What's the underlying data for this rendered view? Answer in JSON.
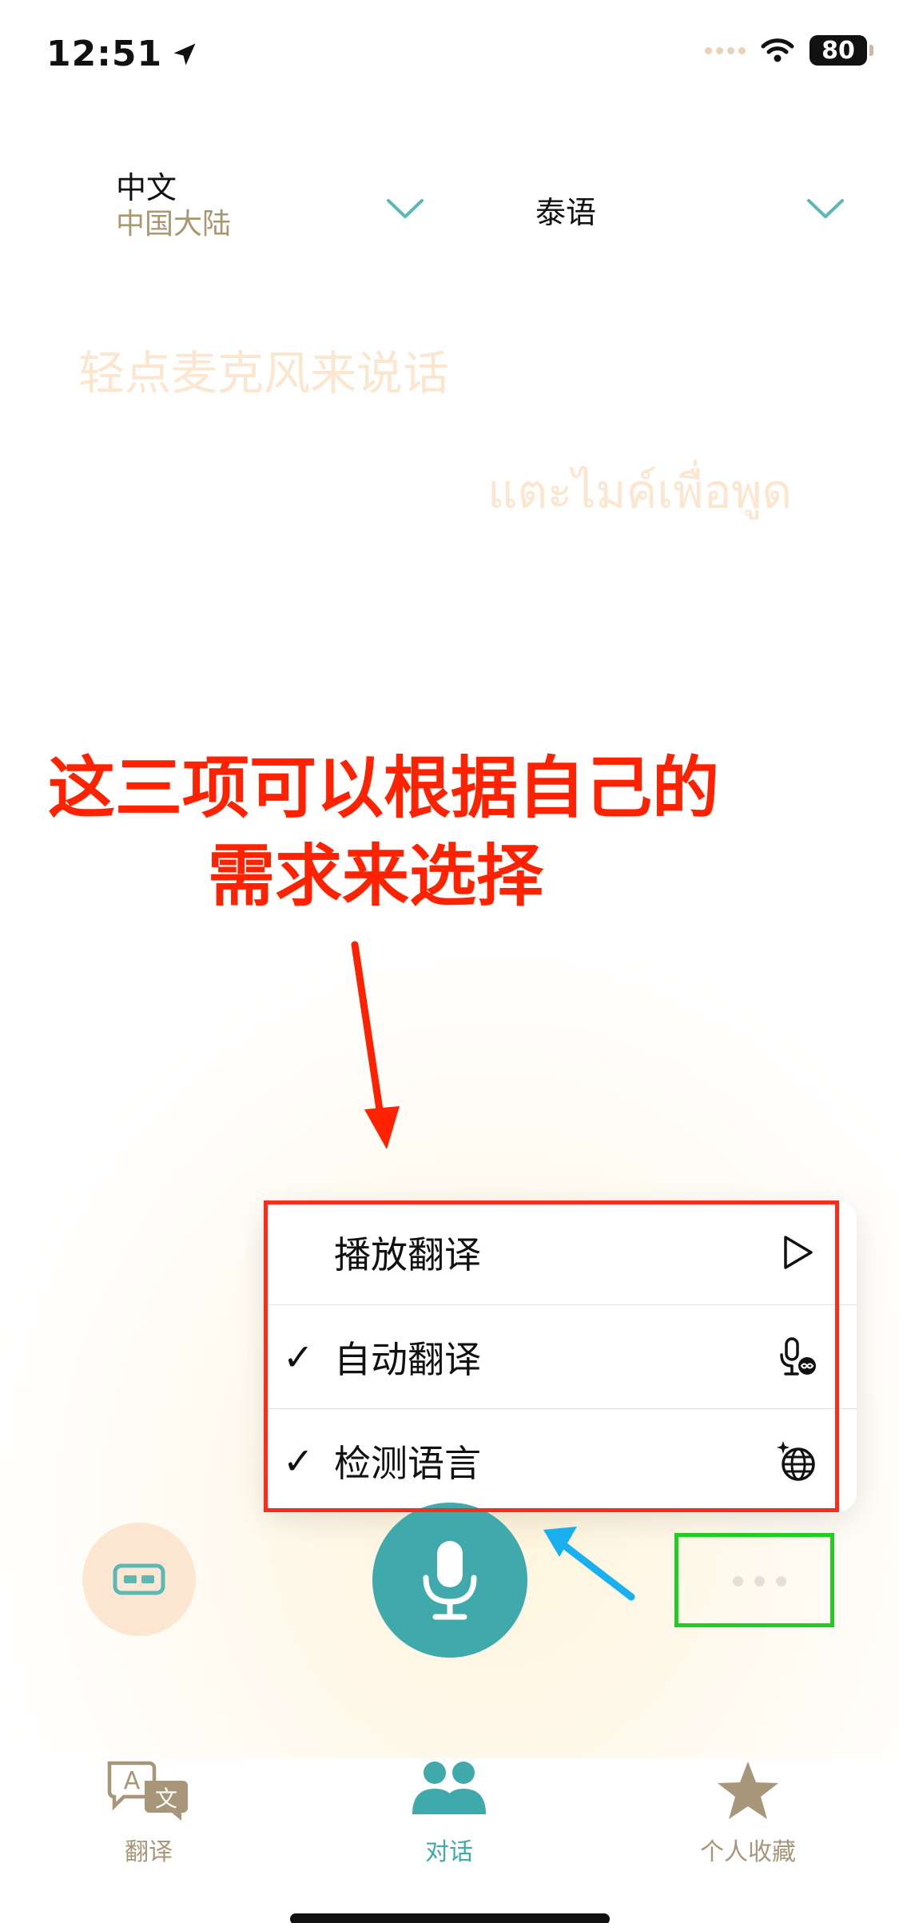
{
  "status_bar": {
    "time": "12:51",
    "battery": "80"
  },
  "source_language": {
    "name": "中文",
    "region": "中国大陆"
  },
  "target_language": {
    "name": "泰语"
  },
  "prompts": {
    "chinese": "轻点麦克风来说话",
    "thai": "แตะไมค์เพื่อพูด"
  },
  "annotation": {
    "line1": "这三项可以根据自己的",
    "line2": "需求来选择"
  },
  "menu": {
    "items": [
      {
        "label": "播放翻译",
        "checked": false,
        "icon": "play-icon",
        "check": ""
      },
      {
        "label": "自动翻译",
        "checked": true,
        "icon": "mic-infinity-icon",
        "check": "✓"
      },
      {
        "label": "检测语言",
        "checked": true,
        "icon": "globe-sparkle-icon",
        "check": "✓"
      }
    ]
  },
  "tabs": [
    {
      "label": "翻译",
      "icon": "translate-icon",
      "active": false
    },
    {
      "label": "对话",
      "icon": "people-icon",
      "active": true
    },
    {
      "label": "个人收藏",
      "icon": "star-icon",
      "active": false
    }
  ],
  "colors": {
    "accent": "#3fa9ac",
    "tab_inactive": "#a8967a",
    "prompt": "#fbe6cf",
    "annotation": "#ff2200",
    "highlight_red": "#ff2a1a",
    "highlight_green": "#22cc22"
  }
}
